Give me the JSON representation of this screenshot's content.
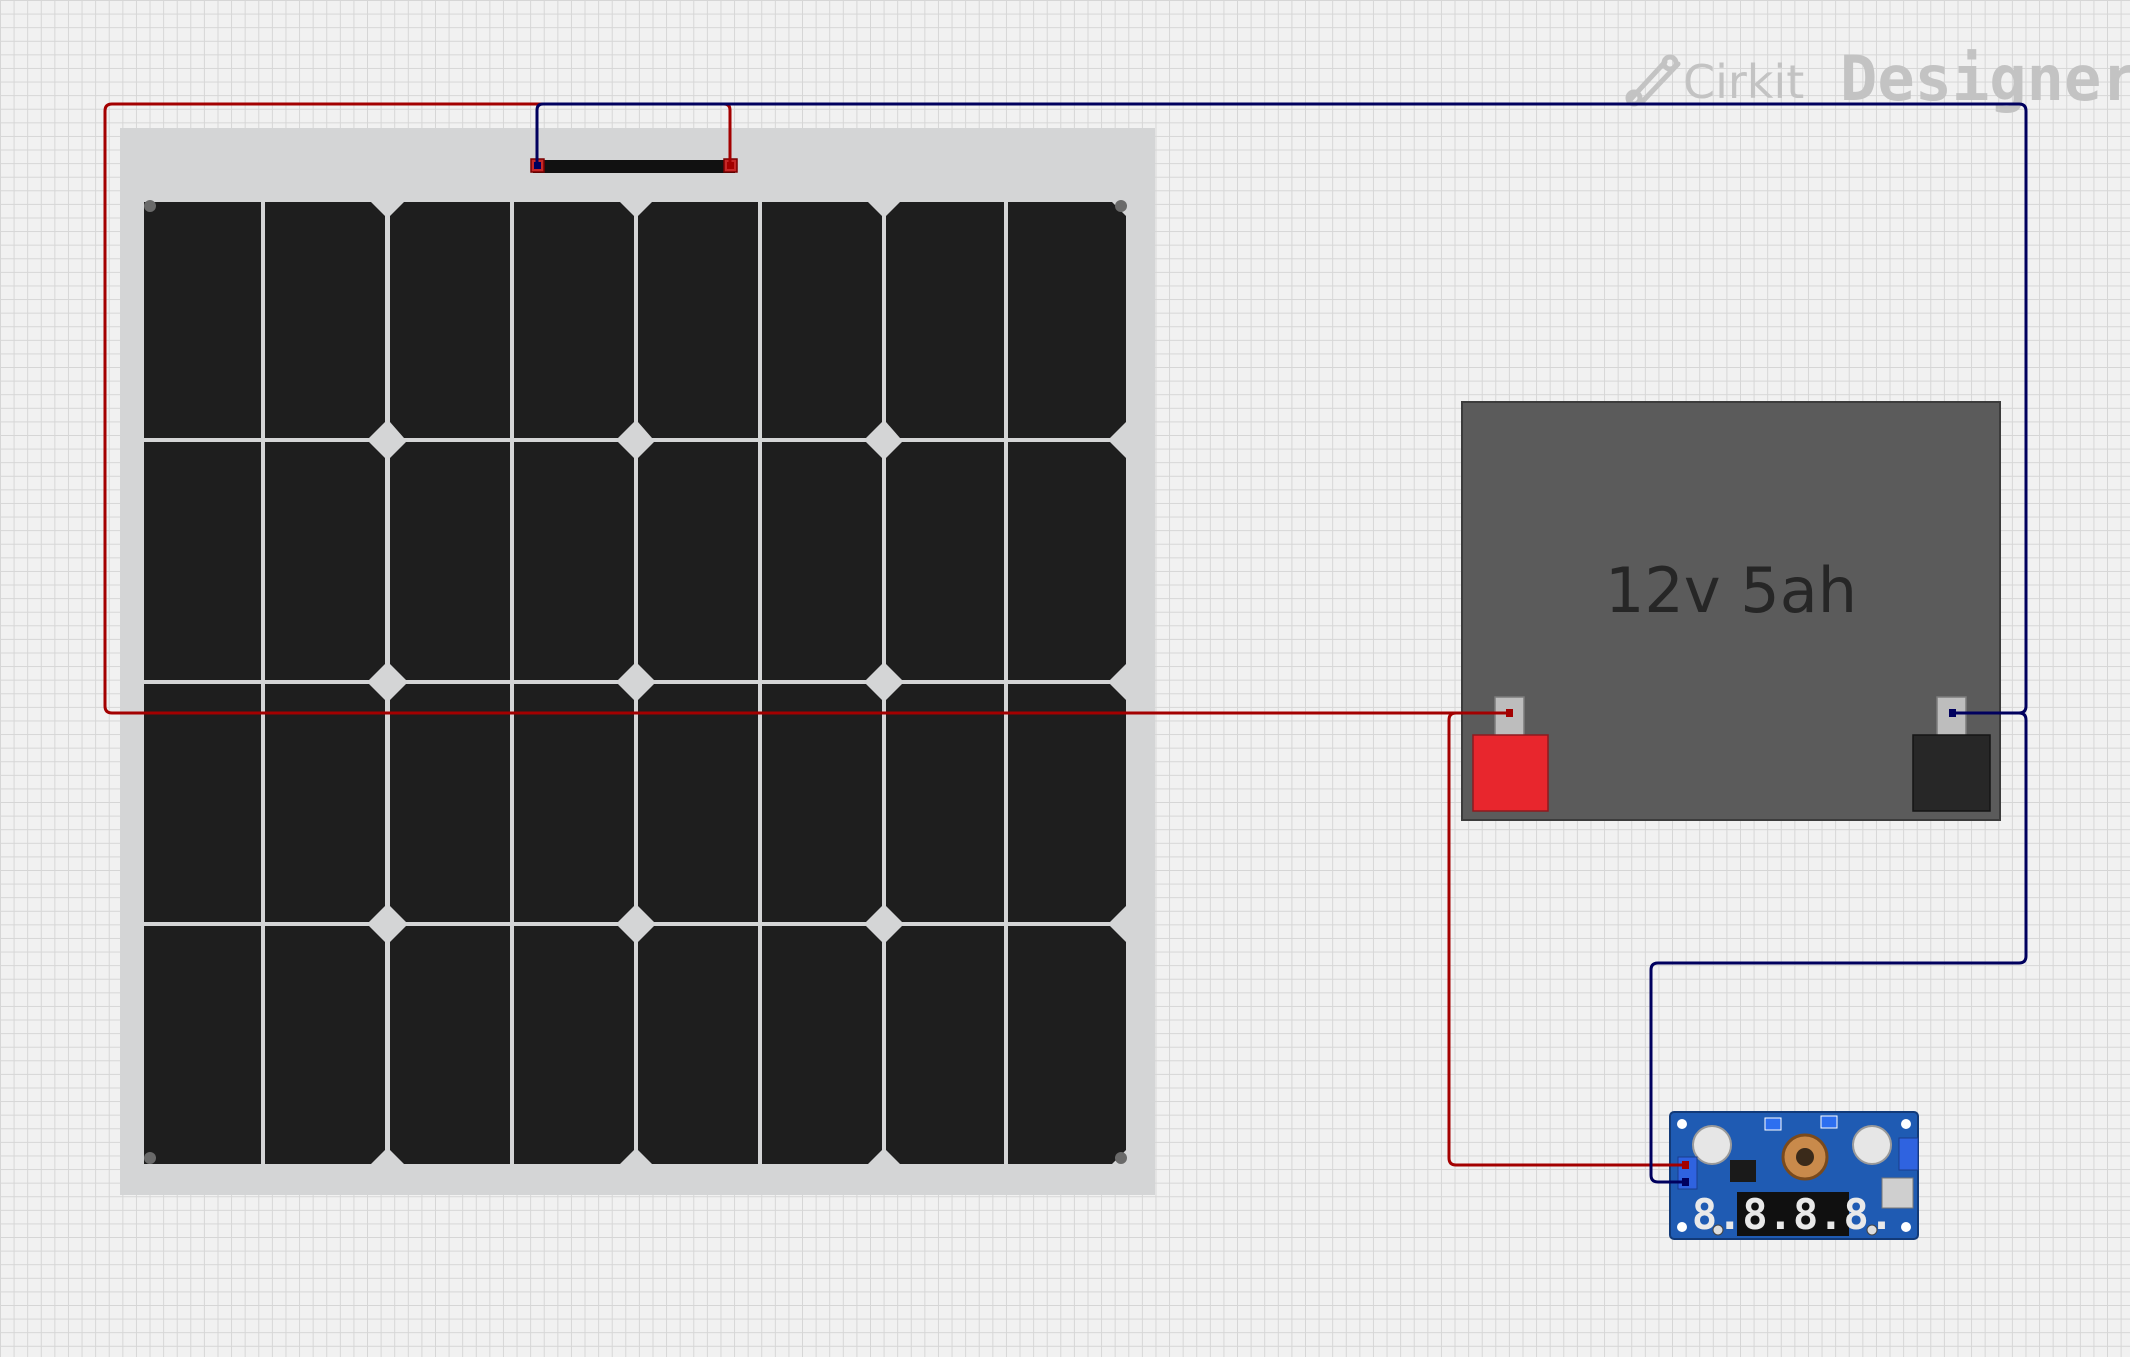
{
  "app": {
    "brand_part1": "Cirkit",
    "brand_part2": "Designer"
  },
  "components": {
    "solar_panel": {
      "rows": 4,
      "columns": 8
    },
    "battery": {
      "label": "12v 5ah",
      "positive_color": "#e8262d",
      "negative_color": "#272727"
    },
    "buck_converter": {
      "display": "8.8.8.8."
    }
  },
  "wires": [
    {
      "name": "wire-solar-positive-to-battery-positive",
      "color": "#a30000"
    },
    {
      "name": "wire-solar-negative-to-battery-negative",
      "color": "#00005e"
    },
    {
      "name": "wire-battery-positive-to-converter-in",
      "color": "#a30000"
    },
    {
      "name": "wire-battery-negative-to-converter-in",
      "color": "#00005e"
    }
  ]
}
